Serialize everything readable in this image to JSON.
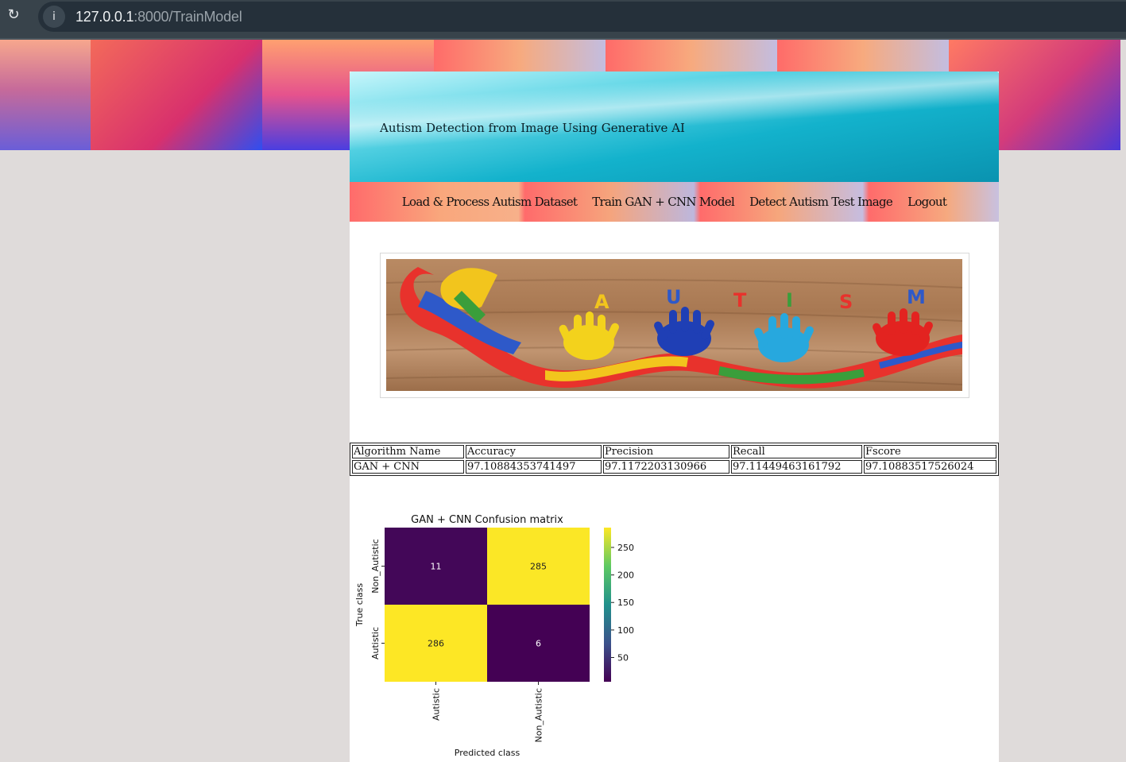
{
  "browser": {
    "url_host": "127.0.0.1",
    "url_path": ":8000/TrainModel",
    "reload_icon": "reload-icon",
    "info_icon": "info-icon"
  },
  "header": {
    "title": "Autism Detection from Image Using Generative AI"
  },
  "nav": {
    "items": [
      {
        "label": "Load & Process Autism Dataset"
      },
      {
        "label": "Train GAN + CNN Model"
      },
      {
        "label": "Detect Autism Test Image"
      },
      {
        "label": "Logout"
      }
    ]
  },
  "banner": {
    "letters": [
      "A",
      "U",
      "T",
      "I",
      "S",
      "M"
    ]
  },
  "results": {
    "headers": [
      "Algorithm Name",
      "Accuracy",
      "Precision",
      "Recall",
      "Fscore"
    ],
    "rows": [
      [
        "GAN + CNN",
        "97.10884353741497",
        "97.1172203130966",
        "97.11449463161792",
        "97.10883517526024"
      ]
    ]
  },
  "chart_data": {
    "type": "heatmap",
    "title": "GAN + CNN Confusion matrix",
    "xlabel": "Predicted class",
    "ylabel": "True class",
    "x_categories": [
      "Autistic",
      "Non_Autistic"
    ],
    "y_categories": [
      "Non_Autistic",
      "Autistic"
    ],
    "values": [
      [
        11,
        285
      ],
      [
        286,
        6
      ]
    ],
    "colormap": "viridis",
    "colorbar_ticks": [
      250,
      200,
      150,
      100,
      50
    ],
    "colorbar_range": [
      6,
      286
    ],
    "colors": {
      "low": "#440154",
      "high": "#fde725"
    }
  }
}
